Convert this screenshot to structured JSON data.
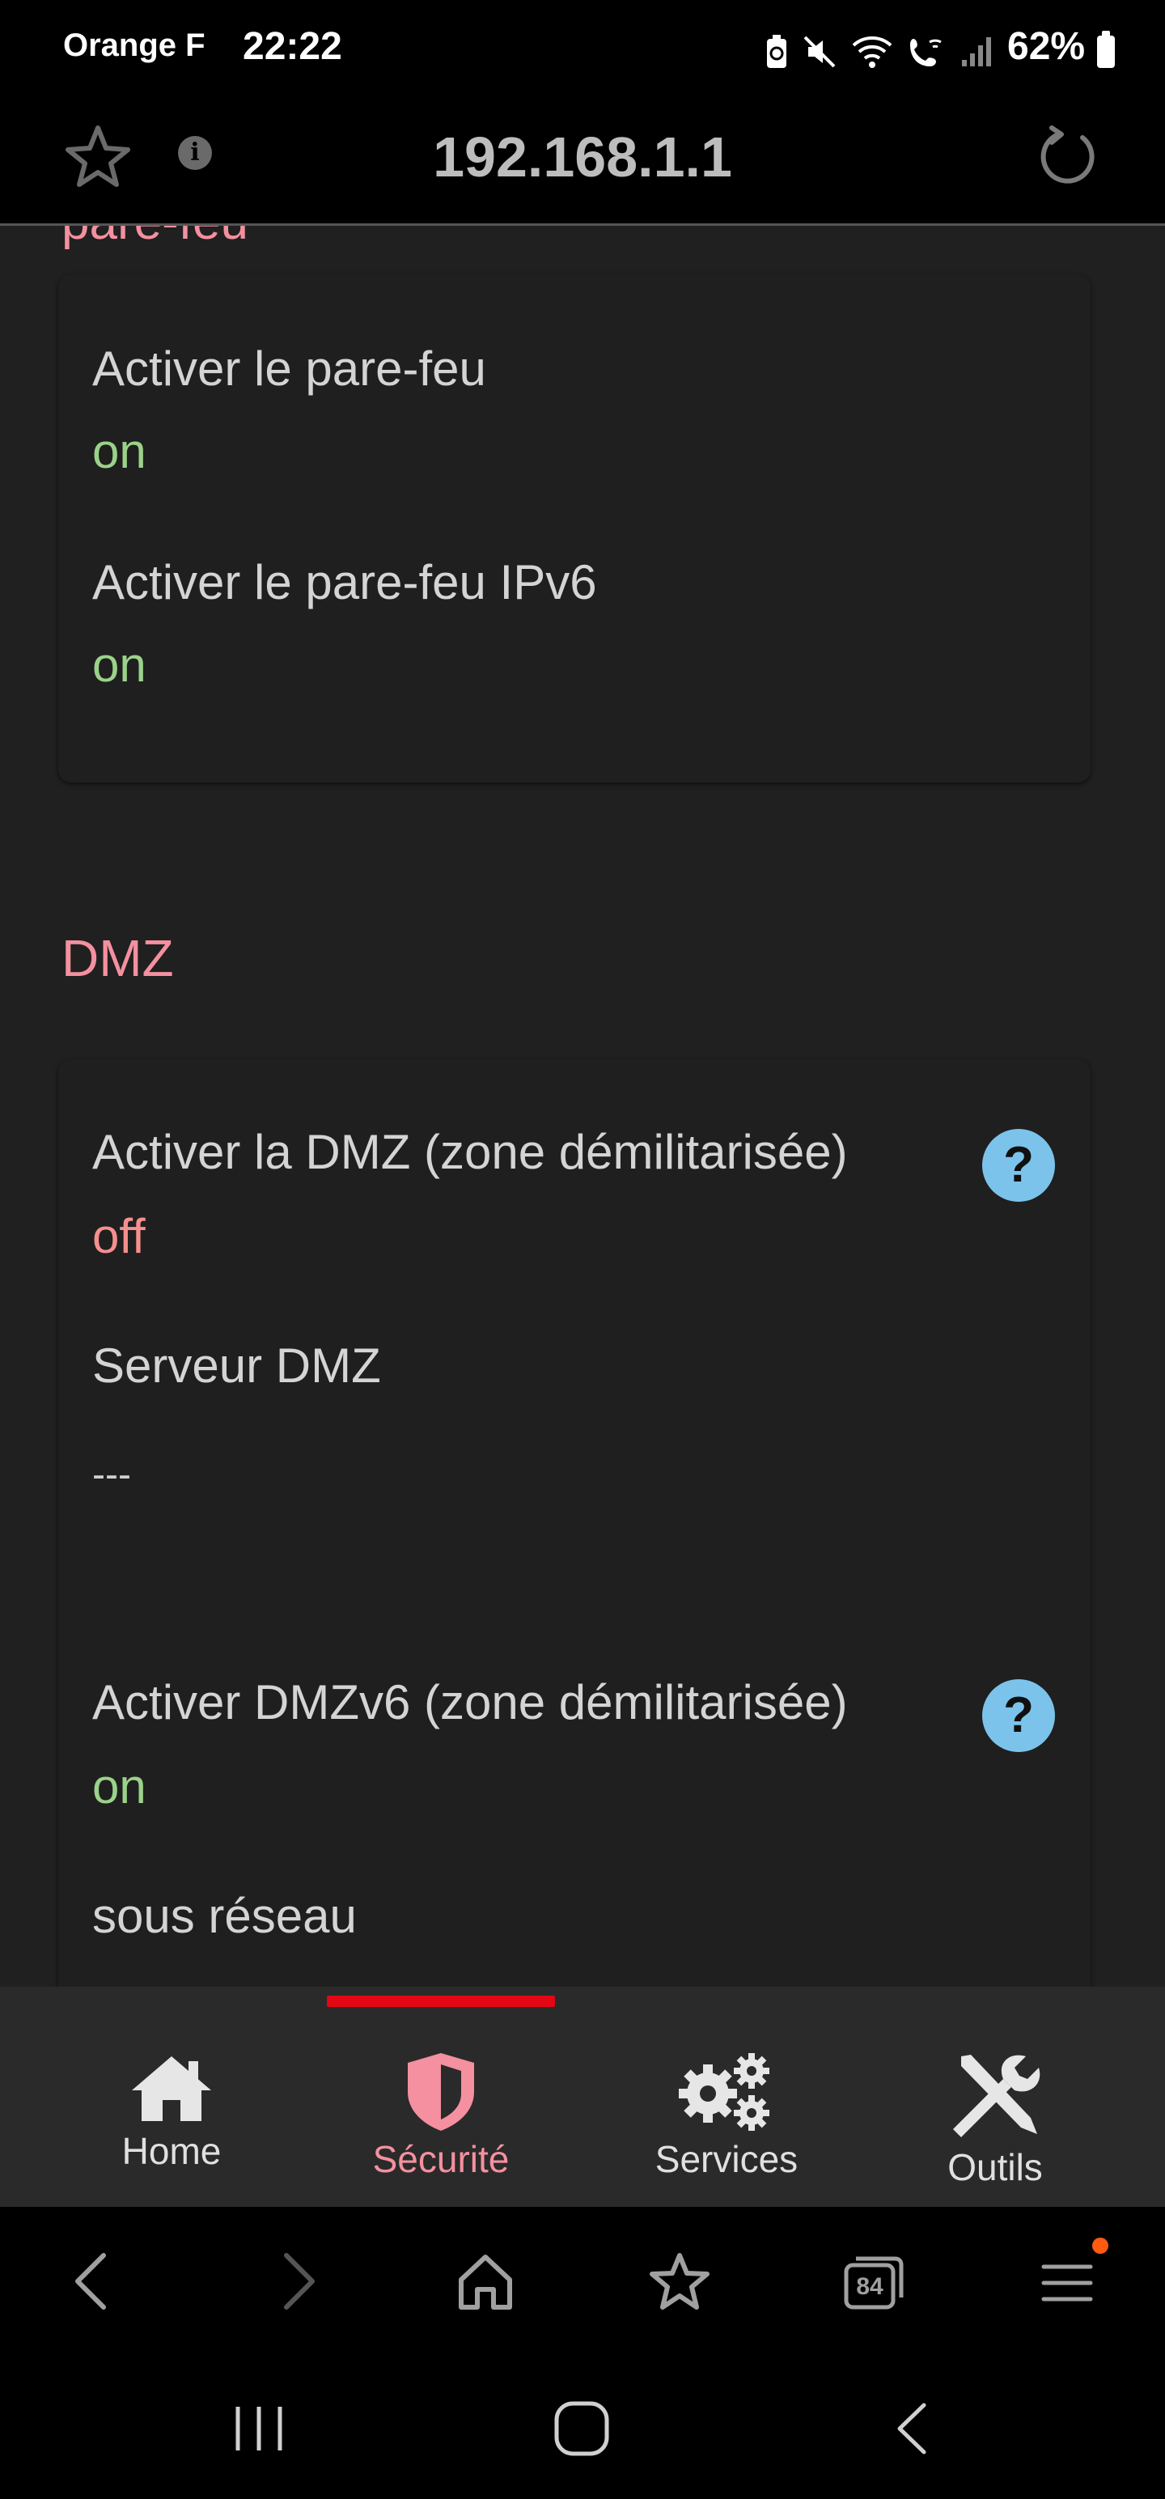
{
  "status_bar": {
    "carrier": "Orange F",
    "time": "22:22",
    "battery": "62%"
  },
  "url_bar": {
    "url": "192.168.1.1"
  },
  "firewall": {
    "partial_title": "pare-feu",
    "rows": [
      {
        "label": "Activer le pare-feu",
        "value": "on"
      },
      {
        "label": "Activer le pare-feu IPv6",
        "value": "on"
      }
    ]
  },
  "dmz": {
    "title": "DMZ",
    "dmz_enable_label": "Activer la DMZ (zone démilitarisée)",
    "dmz_enable_value": "off",
    "server_label": "Serveur DMZ",
    "server_value": "---",
    "dmzv6_enable_label": "Activer DMZv6 (zone démilitarisée)",
    "dmzv6_enable_value": "on",
    "subnet_label": "sous réseau",
    "help_symbol": "?"
  },
  "tabs": [
    {
      "label": "Home",
      "icon": "home-icon"
    },
    {
      "label": "Sécurité",
      "icon": "shield-icon",
      "active": true
    },
    {
      "label": "Services",
      "icon": "gears-icon"
    },
    {
      "label": "Outils",
      "icon": "tools-icon"
    }
  ],
  "browser_toolbar": {
    "tabs_count": "84"
  },
  "colors": {
    "accent_pink": "#f4909f",
    "on_green": "#9bd28a",
    "off_red": "#f68f8f",
    "help_blue": "#7cc3eb",
    "tab_indicator_red": "#e30613"
  }
}
